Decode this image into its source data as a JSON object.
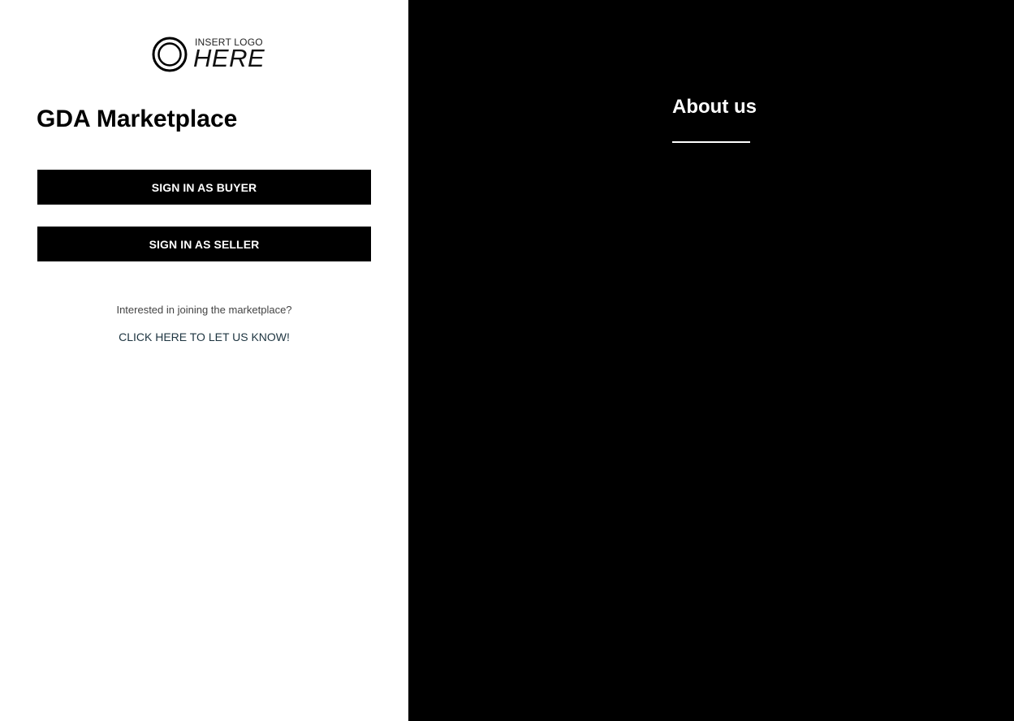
{
  "logo": {
    "small_text": "INSERT LOGO",
    "big_text": "HERE"
  },
  "login": {
    "title": "GDA Marketplace",
    "buyer_button": "SIGN IN AS BUYER",
    "seller_button": "SIGN IN AS SELLER",
    "interest_text": "Interested in joining the marketplace?",
    "cta_link": "CLICK HERE TO LET US KNOW!"
  },
  "about": {
    "title": "About us"
  },
  "colors": {
    "left_background": "#ffffff",
    "right_background": "#000000",
    "button_background": "#000000",
    "button_text": "#ffffff",
    "link_color": "#1d3440"
  }
}
